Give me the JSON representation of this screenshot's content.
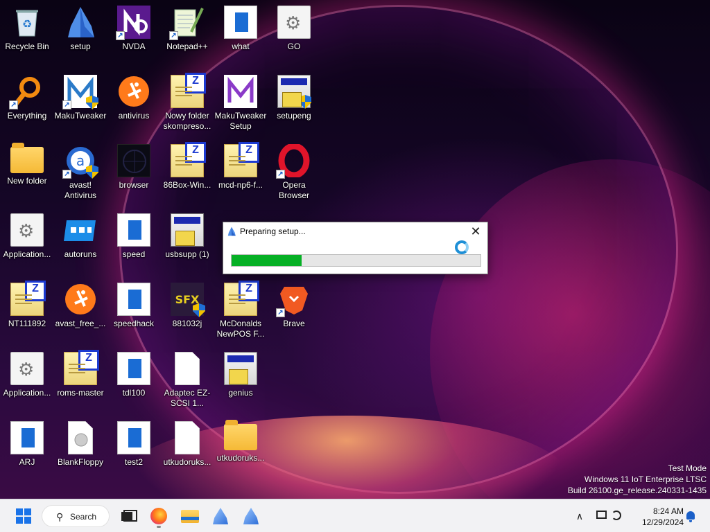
{
  "desktop": {
    "icons": [
      {
        "label": "Recycle Bin",
        "icon": "recycle-bin-icon"
      },
      {
        "label": "setup",
        "icon": "setup-icon"
      },
      {
        "label": "NVDA",
        "icon": "nvda-icon"
      },
      {
        "label": "Notepad++",
        "icon": "notepad-plus-plus-icon"
      },
      {
        "label": "what",
        "icon": "document-icon"
      },
      {
        "label": "GO",
        "icon": "application-gear-icon"
      },
      {
        "label": "Everything",
        "icon": "everything-search-icon"
      },
      {
        "label": "MakuTweaker",
        "icon": "makutweaker-icon"
      },
      {
        "label": "antivirus",
        "icon": "avast-icon"
      },
      {
        "label": "Nowy folder skompreso...",
        "icon": "zip-folder-icon"
      },
      {
        "label": "MakuTweaker Setup",
        "icon": "makutweaker-setup-icon"
      },
      {
        "label": "setupeng",
        "icon": "installer-icon"
      },
      {
        "label": "New folder",
        "icon": "folder-icon"
      },
      {
        "label": "avast! Antivirus",
        "icon": "avast-antivirus-icon"
      },
      {
        "label": "browser",
        "icon": "browser-icon"
      },
      {
        "label": "86Box-Win...",
        "icon": "zip-folder-icon"
      },
      {
        "label": "mcd-np6-f...",
        "icon": "zip-folder-icon"
      },
      {
        "label": "Opera Browser",
        "icon": "opera-icon"
      },
      {
        "label": "Application...",
        "icon": "application-gear-icon"
      },
      {
        "label": "autoruns",
        "icon": "autoruns-icon"
      },
      {
        "label": "speed",
        "icon": "document-icon"
      },
      {
        "label": "usbsupp (1)",
        "icon": "installer-icon"
      },
      {
        "label": "NT111892",
        "icon": "zip-folder-icon"
      },
      {
        "label": "avast_free_...",
        "icon": "avast-icon"
      },
      {
        "label": "speedhack",
        "icon": "document-icon"
      },
      {
        "label": "881032j",
        "icon": "sfx-archive-icon"
      },
      {
        "label": "McDonalds NewPOS F...",
        "icon": "zip-folder-icon"
      },
      {
        "label": "Brave",
        "icon": "brave-icon"
      },
      {
        "label": "Application...",
        "icon": "application-gear-icon"
      },
      {
        "label": "roms-master",
        "icon": "zip-folder-icon"
      },
      {
        "label": "tdl100",
        "icon": "document-icon"
      },
      {
        "label": "Adaptec EZ-SCSI 1...",
        "icon": "blank-page-icon"
      },
      {
        "label": "genius",
        "icon": "installer-icon"
      },
      {
        "label": "ARJ",
        "icon": "document-icon"
      },
      {
        "label": "BlankFloppy",
        "icon": "disk-image-icon"
      },
      {
        "label": "test2",
        "icon": "document-icon"
      },
      {
        "label": "utkudoruks...",
        "icon": "blank-page-icon"
      },
      {
        "label": "utkudoruks...",
        "icon": "folder-icon"
      }
    ]
  },
  "dialog": {
    "title": "Preparing setup...",
    "close_icon": "close-icon",
    "spinner_icon": "loading-spinner-icon",
    "progress": 0.28,
    "progress_color": "#06b025"
  },
  "watermark": {
    "line1": "Test Mode",
    "line2": "Windows 11 IoT Enterprise LTSC",
    "line3": "Build 26100.ge_release.240331-1435"
  },
  "taskbar": {
    "search_label": "Search",
    "apps": [
      "start-icon",
      "task-view-icon",
      "firefox-icon",
      "file-explorer-icon",
      "setup-icon",
      "setup-icon"
    ],
    "time": "8:24 AM",
    "date": "12/29/2024",
    "accent": "#1a73e8"
  }
}
